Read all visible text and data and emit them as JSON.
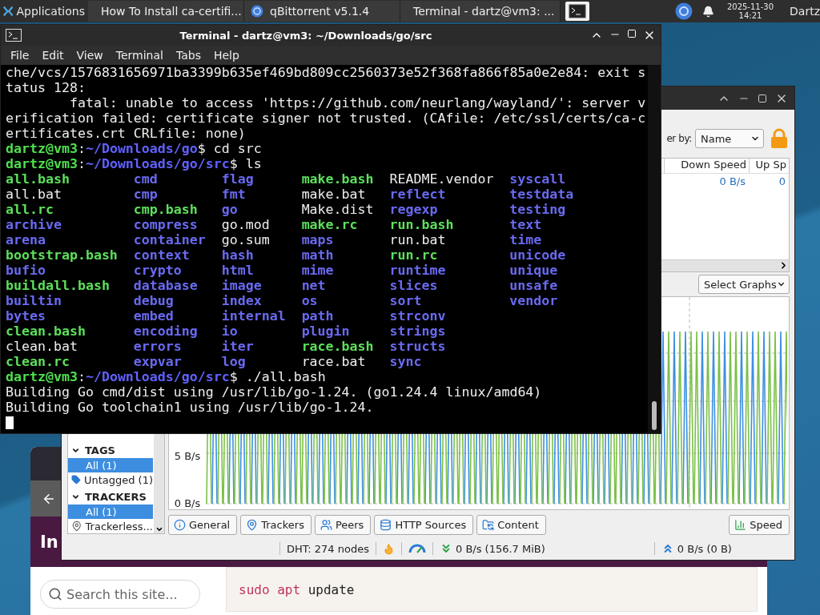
{
  "panel": {
    "apps_label": "Applications",
    "tasks": [
      {
        "label": "How To Install ca-certifi...",
        "kind": "browser"
      },
      {
        "label": "qBittorrent v5.1.4",
        "kind": "torrent"
      },
      {
        "label": "Terminal - dartz@vm3: ...",
        "kind": "terminal"
      }
    ],
    "date": "2025-11-30",
    "time": "14:21",
    "user": "Dartz"
  },
  "browser": {
    "heading": "In",
    "search": {
      "placeholder": "Search this site..."
    },
    "code": [
      {
        "text": "sudo",
        "kind": "keyword"
      },
      {
        "text": " apt",
        "kind": "keyword"
      },
      {
        "text": " update",
        "kind": "plain"
      }
    ]
  },
  "qbittorrent": {
    "filter_label": "er by:",
    "filter_value": "Name",
    "columns": [
      "Down Speed",
      "Up Sp"
    ],
    "rows": [
      [
        "0 B/s",
        "0"
      ]
    ],
    "graph_select": "Select Graphs",
    "y_labels": [
      "5 B/s",
      "0 B/s"
    ],
    "sidebar": [
      {
        "title": "TAGS",
        "expanded": true,
        "items": [
          {
            "label": "All (1)",
            "selected": true,
            "kind": "all"
          },
          {
            "label": "Untagged (1)",
            "selected": false,
            "kind": "tag"
          }
        ]
      },
      {
        "title": "TRACKERS",
        "expanded": true,
        "items": [
          {
            "label": "All (1)",
            "selected": true,
            "kind": "all"
          },
          {
            "label": "Trackerless...",
            "selected": false,
            "kind": "tracker"
          }
        ]
      }
    ],
    "tabs": [
      {
        "label": "General",
        "kind": "info"
      },
      {
        "label": "Trackers",
        "kind": "pin"
      },
      {
        "label": "Peers",
        "kind": "peers"
      },
      {
        "label": "HTTP Sources",
        "kind": "database"
      },
      {
        "label": "Content",
        "kind": "content"
      },
      {
        "label": "Speed",
        "kind": "speed"
      }
    ],
    "status": {
      "dht": "DHT: 274 nodes",
      "download": "0 B/s (156.7 MiB)",
      "upload": "0 B/s (0 B)"
    }
  },
  "terminal": {
    "title": "Terminal - dartz@vm3: ~/Downloads/go/src",
    "menu": [
      "File",
      "Edit",
      "View",
      "Terminal",
      "Tabs",
      "Help"
    ],
    "lines": [
      {
        "kind": "text",
        "segments": [
          {
            "text": "che/vcs/1576831656971ba3399b635ef469bd809cc2560373e52f368fa866f85a0e2e84: exit s",
            "kind": "plain"
          }
        ]
      },
      {
        "kind": "text",
        "segments": [
          {
            "text": "tatus 128:",
            "kind": "plain"
          }
        ]
      },
      {
        "kind": "text",
        "segments": [
          {
            "text": "        fatal: unable to access 'https://github.com/neurlang/wayland/': server v",
            "kind": "plain"
          }
        ]
      },
      {
        "kind": "text",
        "segments": [
          {
            "text": "erification failed: certificate signer not trusted. (CAfile: /etc/ssl/certs/ca-c",
            "kind": "plain"
          }
        ]
      },
      {
        "kind": "text",
        "segments": [
          {
            "text": "ertificates.crt CRLfile: none)",
            "kind": "plain"
          }
        ]
      },
      {
        "kind": "text",
        "segments": [
          {
            "text": "dartz@vm3",
            "kind": "user"
          },
          {
            "text": ":",
            "kind": "plain"
          },
          {
            "text": "~/Downloads/go",
            "kind": "path"
          },
          {
            "text": "$ cd src",
            "kind": "plain"
          }
        ]
      },
      {
        "kind": "text",
        "segments": [
          {
            "text": "dartz@vm3",
            "kind": "user"
          },
          {
            "text": ":",
            "kind": "plain"
          },
          {
            "text": "~/Downloads/go/src",
            "kind": "path"
          },
          {
            "text": "$ ls",
            "kind": "plain"
          }
        ]
      },
      {
        "kind": "ls",
        "rows": [
          [
            {
              "name": "all.bash",
              "kind": "exec"
            },
            {
              "name": "cmd",
              "kind": "dir"
            },
            {
              "name": "flag",
              "kind": "dir"
            },
            {
              "name": "make.bash",
              "kind": "exec"
            },
            {
              "name": "README.vendor",
              "kind": "file"
            },
            {
              "name": "syscall",
              "kind": "dir"
            }
          ],
          [
            {
              "name": "all.bat",
              "kind": "file"
            },
            {
              "name": "cmp",
              "kind": "dir"
            },
            {
              "name": "fmt",
              "kind": "dir"
            },
            {
              "name": "make.bat",
              "kind": "file"
            },
            {
              "name": "reflect",
              "kind": "dir"
            },
            {
              "name": "testdata",
              "kind": "dir"
            }
          ],
          [
            {
              "name": "all.rc",
              "kind": "exec"
            },
            {
              "name": "cmp.bash",
              "kind": "exec"
            },
            {
              "name": "go",
              "kind": "dir"
            },
            {
              "name": "Make.dist",
              "kind": "file"
            },
            {
              "name": "regexp",
              "kind": "dir"
            },
            {
              "name": "testing",
              "kind": "dir"
            }
          ],
          [
            {
              "name": "archive",
              "kind": "dir"
            },
            {
              "name": "compress",
              "kind": "dir"
            },
            {
              "name": "go.mod",
              "kind": "file"
            },
            {
              "name": "make.rc",
              "kind": "exec"
            },
            {
              "name": "run.bash",
              "kind": "exec"
            },
            {
              "name": "text",
              "kind": "dir"
            }
          ],
          [
            {
              "name": "arena",
              "kind": "dir"
            },
            {
              "name": "container",
              "kind": "dir"
            },
            {
              "name": "go.sum",
              "kind": "file"
            },
            {
              "name": "maps",
              "kind": "dir"
            },
            {
              "name": "run.bat",
              "kind": "file"
            },
            {
              "name": "time",
              "kind": "dir"
            }
          ],
          [
            {
              "name": "bootstrap.bash",
              "kind": "exec"
            },
            {
              "name": "context",
              "kind": "dir"
            },
            {
              "name": "hash",
              "kind": "dir"
            },
            {
              "name": "math",
              "kind": "dir"
            },
            {
              "name": "run.rc",
              "kind": "exec"
            },
            {
              "name": "unicode",
              "kind": "dir"
            }
          ],
          [
            {
              "name": "bufio",
              "kind": "dir"
            },
            {
              "name": "crypto",
              "kind": "dir"
            },
            {
              "name": "html",
              "kind": "dir"
            },
            {
              "name": "mime",
              "kind": "dir"
            },
            {
              "name": "runtime",
              "kind": "dir"
            },
            {
              "name": "unique",
              "kind": "dir"
            }
          ],
          [
            {
              "name": "buildall.bash",
              "kind": "exec"
            },
            {
              "name": "database",
              "kind": "dir"
            },
            {
              "name": "image",
              "kind": "dir"
            },
            {
              "name": "net",
              "kind": "dir"
            },
            {
              "name": "slices",
              "kind": "dir"
            },
            {
              "name": "unsafe",
              "kind": "dir"
            }
          ],
          [
            {
              "name": "builtin",
              "kind": "dir"
            },
            {
              "name": "debug",
              "kind": "dir"
            },
            {
              "name": "index",
              "kind": "dir"
            },
            {
              "name": "os",
              "kind": "dir"
            },
            {
              "name": "sort",
              "kind": "dir"
            },
            {
              "name": "vendor",
              "kind": "dir"
            }
          ],
          [
            {
              "name": "bytes",
              "kind": "dir"
            },
            {
              "name": "embed",
              "kind": "dir"
            },
            {
              "name": "internal",
              "kind": "dir"
            },
            {
              "name": "path",
              "kind": "dir"
            },
            {
              "name": "strconv",
              "kind": "dir"
            }
          ],
          [
            {
              "name": "clean.bash",
              "kind": "exec"
            },
            {
              "name": "encoding",
              "kind": "dir"
            },
            {
              "name": "io",
              "kind": "dir"
            },
            {
              "name": "plugin",
              "kind": "dir"
            },
            {
              "name": "strings",
              "kind": "dir"
            }
          ],
          [
            {
              "name": "clean.bat",
              "kind": "file"
            },
            {
              "name": "errors",
              "kind": "dir"
            },
            {
              "name": "iter",
              "kind": "dir"
            },
            {
              "name": "race.bash",
              "kind": "exec"
            },
            {
              "name": "structs",
              "kind": "dir"
            }
          ],
          [
            {
              "name": "clean.rc",
              "kind": "exec"
            },
            {
              "name": "expvar",
              "kind": "dir"
            },
            {
              "name": "log",
              "kind": "dir"
            },
            {
              "name": "race.bat",
              "kind": "file"
            },
            {
              "name": "sync",
              "kind": "dir"
            }
          ]
        ]
      },
      {
        "kind": "text",
        "segments": [
          {
            "text": "dartz@vm3",
            "kind": "user"
          },
          {
            "text": ":",
            "kind": "plain"
          },
          {
            "text": "~/Downloads/go/src",
            "kind": "path"
          },
          {
            "text": "$ ./all.bash",
            "kind": "plain"
          }
        ]
      },
      {
        "kind": "text",
        "segments": [
          {
            "text": "Building Go cmd/dist using /usr/lib/go-1.24. (go1.24.4 linux/amd64)",
            "kind": "plain"
          }
        ]
      },
      {
        "kind": "text",
        "segments": [
          {
            "text": "Building Go toolchain1 using /usr/lib/go-1.24.",
            "kind": "plain"
          }
        ]
      },
      {
        "kind": "cursor"
      }
    ]
  }
}
